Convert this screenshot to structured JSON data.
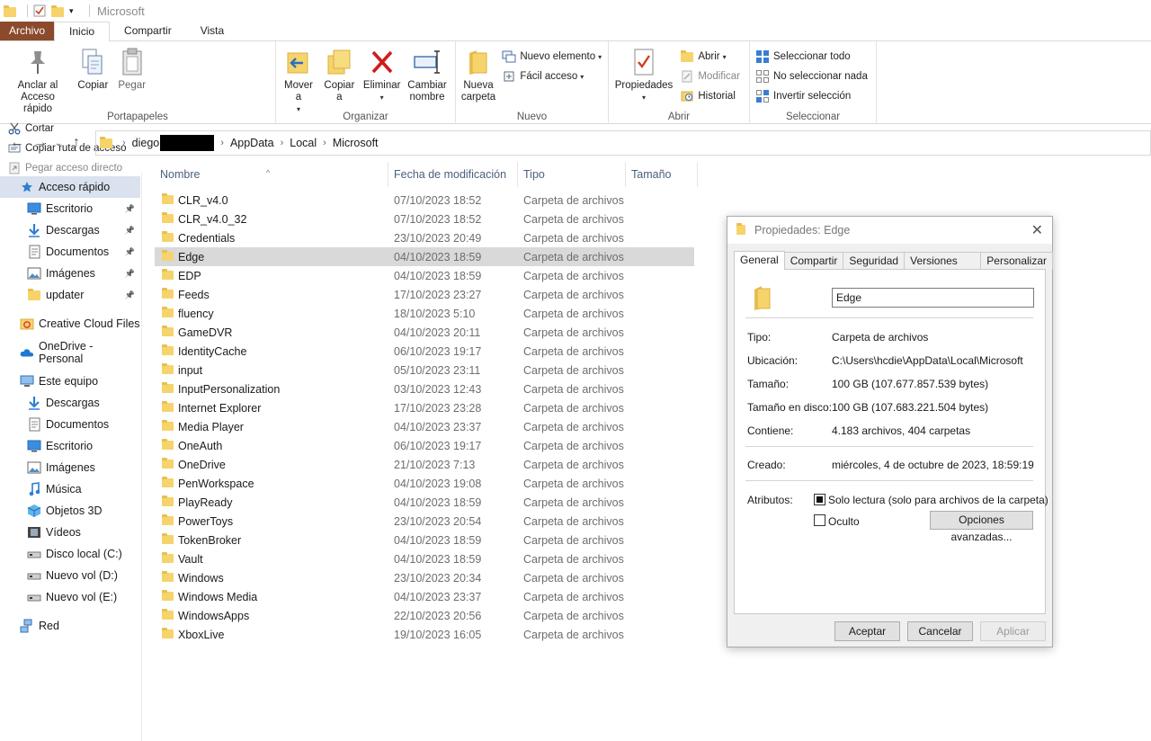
{
  "window": {
    "title": "Microsoft"
  },
  "ribbon_tabs": [
    "Archivo",
    "Inicio",
    "Compartir",
    "Vista"
  ],
  "ribbon": {
    "portapapeles": {
      "label": "Portapapeles",
      "anclar": "Anclar al\nAcceso rápido",
      "copiar": "Copiar",
      "pegar": "Pegar",
      "cortar": "Cortar",
      "copiar_ruta": "Copiar ruta de acceso",
      "pegar_acceso": "Pegar acceso directo"
    },
    "organizar": {
      "label": "Organizar",
      "mover": "Mover\na",
      "copiar_a": "Copiar\na",
      "eliminar": "Eliminar",
      "cambiar": "Cambiar\nnombre"
    },
    "nuevo": {
      "label": "Nuevo",
      "nueva_carpeta": "Nueva\ncarpeta",
      "nuevo_elemento": "Nuevo elemento",
      "facil_acceso": "Fácil acceso"
    },
    "abrir": {
      "label": "Abrir",
      "propiedades": "Propiedades",
      "abrir": "Abrir",
      "modificar": "Modificar",
      "historial": "Historial"
    },
    "seleccionar": {
      "label": "Seleccionar",
      "todo": "Seleccionar todo",
      "ninguno": "No seleccionar nada",
      "invertir": "Invertir selección"
    }
  },
  "breadcrumb": [
    "diego",
    "AppData",
    "Local",
    "Microsoft"
  ],
  "sidebar": [
    {
      "label": "Acceso rápido",
      "icon": "star-icon",
      "selected": true
    },
    {
      "label": "Escritorio",
      "icon": "desktop-icon",
      "pinned": true
    },
    {
      "label": "Descargas",
      "icon": "download-icon",
      "pinned": true
    },
    {
      "label": "Documentos",
      "icon": "document-icon",
      "pinned": true
    },
    {
      "label": "Imágenes",
      "icon": "pictures-icon",
      "pinned": true
    },
    {
      "label": "updater",
      "icon": "folder-icon",
      "pinned": true
    },
    {
      "label": "Creative Cloud Files",
      "icon": "creative-cloud-icon"
    },
    {
      "label": "OneDrive - Personal",
      "icon": "cloud-icon"
    },
    {
      "label": "Este equipo",
      "icon": "computer-icon"
    },
    {
      "label": "Descargas",
      "icon": "download-icon"
    },
    {
      "label": "Documentos",
      "icon": "document-icon"
    },
    {
      "label": "Escritorio",
      "icon": "desktop-icon"
    },
    {
      "label": "Imágenes",
      "icon": "pictures-icon"
    },
    {
      "label": "Música",
      "icon": "music-icon"
    },
    {
      "label": "Objetos 3D",
      "icon": "cube-icon"
    },
    {
      "label": "Vídeos",
      "icon": "video-icon"
    },
    {
      "label": "Disco local (C:)",
      "icon": "drive-icon"
    },
    {
      "label": "Nuevo vol (D:)",
      "icon": "drive-icon"
    },
    {
      "label": "Nuevo vol (E:)",
      "icon": "drive-icon"
    },
    {
      "label": "Red",
      "icon": "network-icon"
    }
  ],
  "columns": [
    "Nombre",
    "Fecha de modificación",
    "Tipo",
    "Tamaño"
  ],
  "files": [
    {
      "name": "CLR_v4.0",
      "date": "07/10/2023 18:52",
      "type": "Carpeta de archivos"
    },
    {
      "name": "CLR_v4.0_32",
      "date": "07/10/2023 18:52",
      "type": "Carpeta de archivos"
    },
    {
      "name": "Credentials",
      "date": "23/10/2023 20:49",
      "type": "Carpeta de archivos"
    },
    {
      "name": "Edge",
      "date": "04/10/2023 18:59",
      "type": "Carpeta de archivos",
      "selected": true
    },
    {
      "name": "EDP",
      "date": "04/10/2023 18:59",
      "type": "Carpeta de archivos"
    },
    {
      "name": "Feeds",
      "date": "17/10/2023 23:27",
      "type": "Carpeta de archivos"
    },
    {
      "name": "fluency",
      "date": "18/10/2023 5:10",
      "type": "Carpeta de archivos"
    },
    {
      "name": "GameDVR",
      "date": "04/10/2023 20:11",
      "type": "Carpeta de archivos"
    },
    {
      "name": "IdentityCache",
      "date": "06/10/2023 19:17",
      "type": "Carpeta de archivos"
    },
    {
      "name": "input",
      "date": "05/10/2023 23:11",
      "type": "Carpeta de archivos"
    },
    {
      "name": "InputPersonalization",
      "date": "03/10/2023 12:43",
      "type": "Carpeta de archivos"
    },
    {
      "name": "Internet Explorer",
      "date": "17/10/2023 23:28",
      "type": "Carpeta de archivos"
    },
    {
      "name": "Media Player",
      "date": "04/10/2023 23:37",
      "type": "Carpeta de archivos"
    },
    {
      "name": "OneAuth",
      "date": "06/10/2023 19:17",
      "type": "Carpeta de archivos"
    },
    {
      "name": "OneDrive",
      "date": "21/10/2023 7:13",
      "type": "Carpeta de archivos"
    },
    {
      "name": "PenWorkspace",
      "date": "04/10/2023 19:08",
      "type": "Carpeta de archivos"
    },
    {
      "name": "PlayReady",
      "date": "04/10/2023 18:59",
      "type": "Carpeta de archivos"
    },
    {
      "name": "PowerToys",
      "date": "23/10/2023 20:54",
      "type": "Carpeta de archivos"
    },
    {
      "name": "TokenBroker",
      "date": "04/10/2023 18:59",
      "type": "Carpeta de archivos"
    },
    {
      "name": "Vault",
      "date": "04/10/2023 18:59",
      "type": "Carpeta de archivos"
    },
    {
      "name": "Windows",
      "date": "23/10/2023 20:34",
      "type": "Carpeta de archivos"
    },
    {
      "name": "Windows Media",
      "date": "04/10/2023 23:37",
      "type": "Carpeta de archivos"
    },
    {
      "name": "WindowsApps",
      "date": "22/10/2023 20:56",
      "type": "Carpeta de archivos"
    },
    {
      "name": "XboxLive",
      "date": "19/10/2023 16:05",
      "type": "Carpeta de archivos"
    }
  ],
  "dialog": {
    "title": "Propiedades: Edge",
    "tabs": [
      "General",
      "Compartir",
      "Seguridad",
      "Versiones anteriores",
      "Personalizar"
    ],
    "name": "Edge",
    "props": [
      {
        "label": "Tipo:",
        "value": "Carpeta de archivos"
      },
      {
        "label": "Ubicación:",
        "value": "C:\\Users\\hcdie\\AppData\\Local\\Microsoft"
      },
      {
        "label": "Tamaño:",
        "value": "100 GB (107.677.857.539 bytes)"
      },
      {
        "label": "Tamaño en disco:",
        "value": "100 GB (107.683.221.504 bytes)"
      },
      {
        "label": "Contiene:",
        "value": "4.183 archivos, 404 carpetas"
      }
    ],
    "created_label": "Creado:",
    "created_value": "miércoles, 4 de octubre de 2023, 18:59:19",
    "attributes_label": "Atributos:",
    "readonly_label": "Solo lectura (solo para archivos de la carpeta)",
    "hidden_label": "Oculto",
    "advanced_button": "Opciones avanzadas...",
    "ok": "Aceptar",
    "cancel": "Cancelar",
    "apply": "Aplicar"
  },
  "colors": {
    "file_tab": "#8a4a2c",
    "folder": "#f6d36b",
    "selection": "#d9d9d9",
    "nav_selection": "#d9e2ee"
  }
}
